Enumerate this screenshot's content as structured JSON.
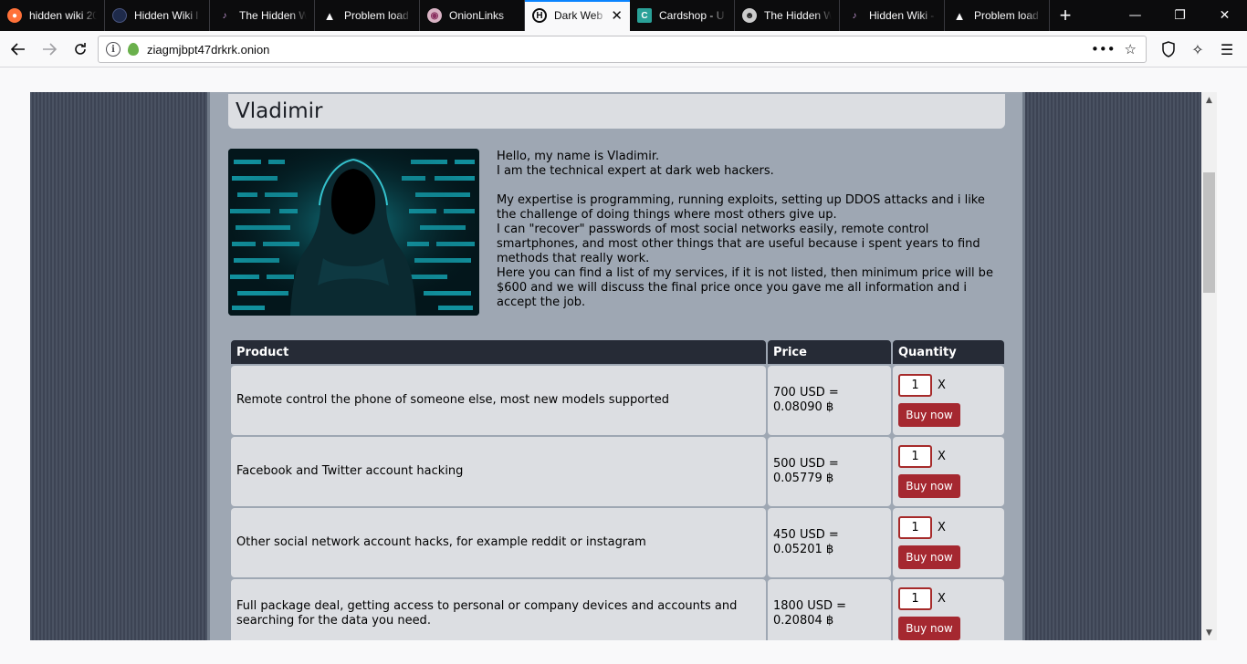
{
  "tabs": [
    {
      "title": "hidden wiki 20",
      "icon": "onion-icon",
      "color": "#ff7139"
    },
    {
      "title": "Hidden Wiki l",
      "icon": "circle-logo-icon",
      "color": "#1e2a4a"
    },
    {
      "title": "The Hidden W",
      "icon": "onion-icon",
      "color": "#7d4698"
    },
    {
      "title": "Problem load",
      "icon": "warning-icon",
      "color": "#f9f9fa"
    },
    {
      "title": "OnionLinks",
      "icon": "onion-icon",
      "color": "#d9b3c4"
    },
    {
      "title": "Dark Web",
      "icon": "h-logo-icon",
      "color": "#0c0c0d",
      "active": true
    },
    {
      "title": "Cardshop - U",
      "icon": "card-logo-icon",
      "color": "#2aa198"
    },
    {
      "title": "The Hidden W",
      "icon": "mask-icon",
      "color": "#cccccc"
    },
    {
      "title": "Hidden Wiki -",
      "icon": "onion-icon",
      "color": "#7d4698"
    },
    {
      "title": "Problem load",
      "icon": "warning-icon",
      "color": "#f9f9fa"
    }
  ],
  "urlbar": {
    "url": "ziagmjbpt47drkrk.onion"
  },
  "page": {
    "title": "Vladimir",
    "intro": "Hello, my name is Vladimir.\nI am the technical expert at dark web hackers.\n\nMy expertise is programming, running exploits, setting up DDOS attacks and i like the challenge of doing things where most others give up.\nI can \"recover\" passwords of most social networks easily, remote control smartphones, and most other things that are useful because i spent years to find methods that really work.\nHere you can find a list of my services, if it is not listed, then minimum price will be $600 and we will discuss the final price once you gave me all information and i accept the job.",
    "table": {
      "headers": [
        "Product",
        "Price",
        "Quantity"
      ],
      "rows": [
        {
          "product": "Remote control the phone of someone else, most new models supported",
          "price_usd": "700 USD =",
          "price_btc": "0.08090 ฿",
          "qty": "1"
        },
        {
          "product": "Facebook and Twitter account hacking",
          "price_usd": "500 USD =",
          "price_btc": "0.05779 ฿",
          "qty": "1"
        },
        {
          "product": "Other social network account hacks, for example reddit or instagram",
          "price_usd": "450 USD =",
          "price_btc": "0.05201 ฿",
          "qty": "1"
        },
        {
          "product": "Full package deal, getting access to personal or company devices and accounts and searching for the data you need.",
          "price_usd": "1800 USD =",
          "price_btc": "0.20804 ฿",
          "qty": "1"
        }
      ],
      "multiply_label": "X",
      "buy_label": "Buy now"
    }
  }
}
